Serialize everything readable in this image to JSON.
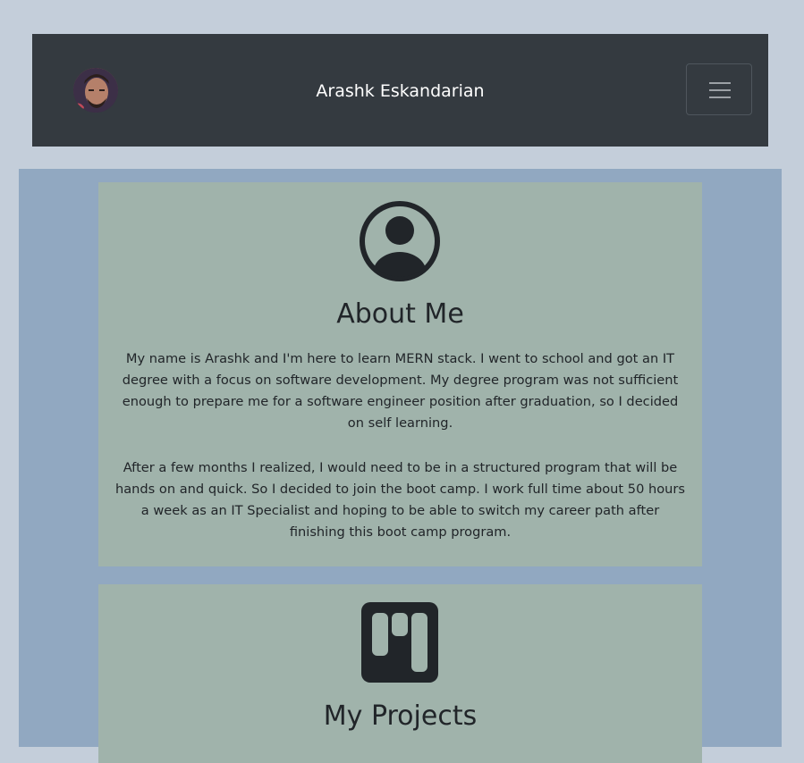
{
  "navbar": {
    "brand": "Arashk Eskandarian",
    "avatar_icon": "avatar-photo",
    "toggler_icon": "hamburger-menu-icon"
  },
  "about": {
    "icon": "user-circle-icon",
    "title": "About Me",
    "paragraphs": [
      "My name is Arashk and I'm here to learn MERN stack. I went to school and got an IT degree with a focus on software development. My degree program was not sufficient enough to prepare me for a software engineer position after graduation, so I decided on self learning.",
      "After a few months I realized, I would need to be in a structured program that will be hands on and quick. So I decided to join the boot camp. I work full time about 50 hours a week as an IT Specialist and hoping to be able to switch my career path after finishing this boot camp program."
    ]
  },
  "projects": {
    "icon": "kanban-board-icon",
    "title": "My Projects"
  },
  "colors": {
    "page_bg": "#c4ceda",
    "navbar_bg": "#343a40",
    "main_bg": "#91a8c1",
    "card_bg": "#a0b3ab",
    "text": "#212529"
  }
}
